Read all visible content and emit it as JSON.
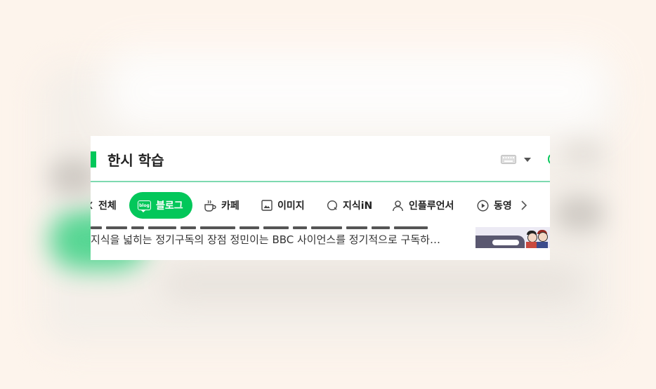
{
  "search": {
    "query": "한시 학습"
  },
  "tabs": [
    {
      "label": "전체",
      "icon": "all-icon",
      "active": false
    },
    {
      "label": "블로그",
      "icon": "blog-icon",
      "badge": "blog",
      "active": true
    },
    {
      "label": "카페",
      "icon": "cafe-icon",
      "active": false
    },
    {
      "label": "이미지",
      "icon": "image-icon",
      "active": false
    },
    {
      "label": "지식iN",
      "icon": "kin-icon",
      "active": false
    },
    {
      "label": "인플루언서",
      "icon": "influencer-icon",
      "active": false
    },
    {
      "label": "동영",
      "icon": "video-icon",
      "active": false
    }
  ],
  "result": {
    "snippet": "지식을 넓히는 정기구독의 장점 정민이는 BBC 사이언스를 정기적으로 구독하…"
  },
  "colors": {
    "brand": "#03c75a",
    "background": "#fdf4ec"
  }
}
